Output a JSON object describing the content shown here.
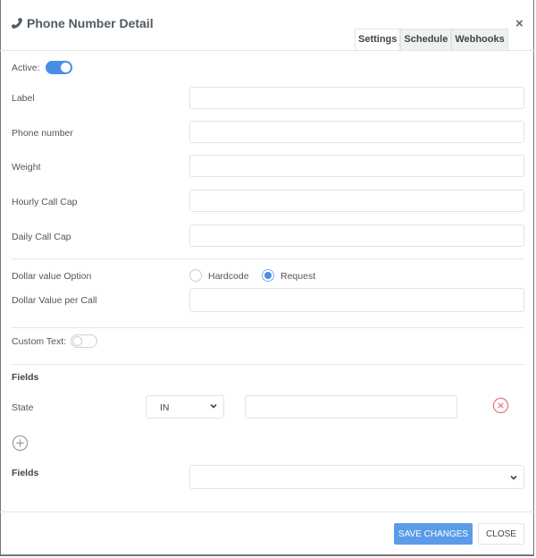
{
  "modal": {
    "title": "Phone Number Detail",
    "title_icon": "phone-icon",
    "close_icon": "close-icon",
    "close_glyph": "×"
  },
  "tabs": [
    {
      "label": "Settings",
      "active": true
    },
    {
      "label": "Schedule",
      "active": false
    },
    {
      "label": "Webhooks",
      "active": false
    }
  ],
  "form": {
    "active": {
      "label": "Active:",
      "value": true
    },
    "label_field": {
      "label": "Label",
      "value": ""
    },
    "phone_number": {
      "label": "Phone number",
      "value": ""
    },
    "weight": {
      "label": "Weight",
      "value": ""
    },
    "hourly_call_cap": {
      "label": "Hourly Call Cap",
      "value": ""
    },
    "daily_call_cap": {
      "label": "Daily Call Cap",
      "value": ""
    },
    "dollar_value_option": {
      "label": "Dollar value Option",
      "options": [
        "Hardcode",
        "Request"
      ],
      "selected": "Request"
    },
    "dollar_value_per_call": {
      "label": "Dollar Value per Call",
      "value": ""
    },
    "custom_text": {
      "label": "Custom Text:",
      "value": false
    },
    "fields_section": {
      "heading": "Fields",
      "rows": [
        {
          "label": "State",
          "operator": "IN",
          "value": ""
        }
      ],
      "add_icon": "plus-circle-icon",
      "remove_icon": "x-circle-icon"
    },
    "fields_select": {
      "label": "Fields",
      "value": ""
    }
  },
  "footer": {
    "save_label": "SAVE CHANGES",
    "close_label": "CLOSE"
  },
  "colors": {
    "primary": "#5b9be8",
    "toggle_on": "#4a8de8",
    "danger": "#e07a7a"
  }
}
